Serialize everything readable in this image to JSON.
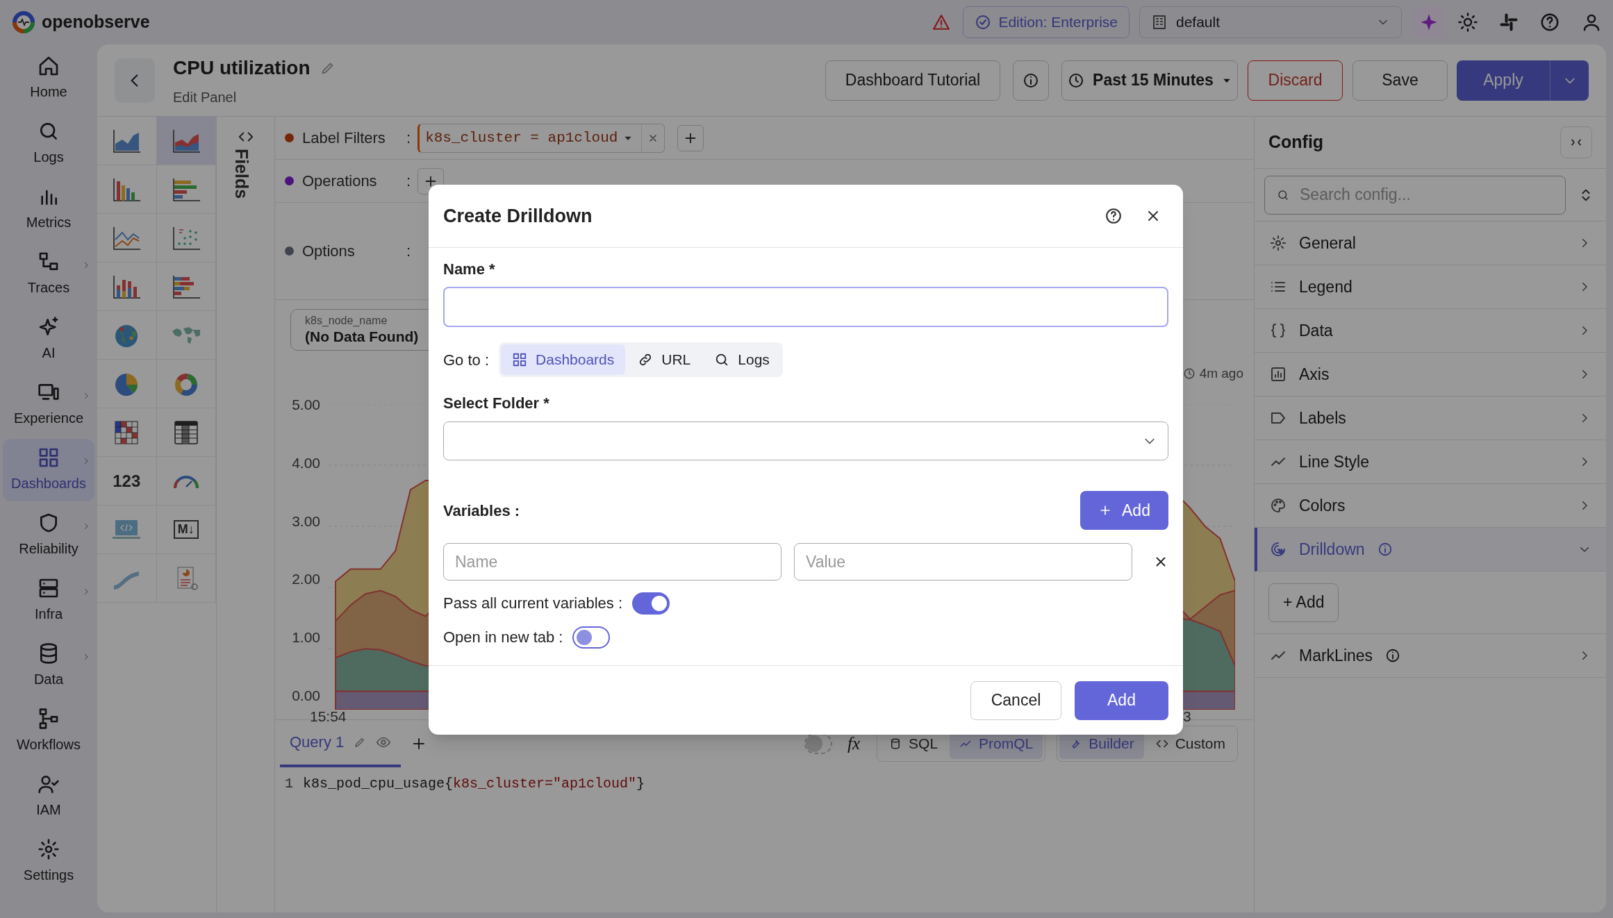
{
  "app": {
    "brand": "openobserve"
  },
  "top_bar": {
    "edition": "Edition: Enterprise",
    "organization": "default"
  },
  "nav": [
    {
      "label": "Home",
      "kind": "home",
      "submenu": false,
      "selected": false
    },
    {
      "label": "Logs",
      "kind": "logs",
      "submenu": false,
      "selected": false
    },
    {
      "label": "Metrics",
      "kind": "metrics",
      "submenu": false,
      "selected": false
    },
    {
      "label": "Traces",
      "kind": "traces",
      "submenu": true,
      "selected": false
    },
    {
      "label": "AI",
      "kind": "ai",
      "submenu": false,
      "selected": false
    },
    {
      "label": "Experience",
      "kind": "experience",
      "submenu": true,
      "selected": false
    },
    {
      "label": "Dashboards",
      "kind": "dashboards",
      "submenu": true,
      "selected": true
    },
    {
      "label": "Reliability",
      "kind": "reliability",
      "submenu": true,
      "selected": false
    },
    {
      "label": "Infra",
      "kind": "infra",
      "submenu": true,
      "selected": false
    },
    {
      "label": "Data",
      "kind": "data",
      "submenu": true,
      "selected": false
    },
    {
      "label": "Workflows",
      "kind": "workflows",
      "submenu": false,
      "selected": false
    },
    {
      "label": "IAM",
      "kind": "iam",
      "submenu": false,
      "selected": false
    },
    {
      "label": "Settings",
      "kind": "settings",
      "submenu": false,
      "selected": false
    }
  ],
  "panel": {
    "title": "CPU utilization",
    "subtitle": "Edit Panel",
    "tutorial": "Dashboard Tutorial",
    "time_range": "Past 15 Minutes",
    "discard": "Discard",
    "save": "Save",
    "apply": "Apply"
  },
  "chart_types": [
    {
      "kind": "area",
      "selected": false
    },
    {
      "kind": "area-stacked",
      "selected": true
    },
    {
      "kind": "bar",
      "selected": false
    },
    {
      "kind": "h-bar",
      "selected": false
    },
    {
      "kind": "line",
      "selected": false
    },
    {
      "kind": "scatter",
      "selected": false
    },
    {
      "kind": "stacked-bar",
      "selected": false
    },
    {
      "kind": "h-stacked",
      "selected": false
    },
    {
      "kind": "geomap",
      "selected": false
    },
    {
      "kind": "maps",
      "selected": false
    },
    {
      "kind": "pie",
      "selected": false
    },
    {
      "kind": "donut",
      "selected": false
    },
    {
      "kind": "heatmap",
      "selected": false
    },
    {
      "kind": "table",
      "selected": false
    },
    {
      "kind": "metric",
      "selected": false,
      "glyph": "123"
    },
    {
      "kind": "gauge",
      "selected": false
    },
    {
      "kind": "html",
      "selected": false
    },
    {
      "kind": "markdown",
      "selected": false,
      "glyph": "M↓"
    },
    {
      "kind": "sankey",
      "selected": false
    },
    {
      "kind": "custom",
      "selected": false
    }
  ],
  "fields_toggle": "Fields",
  "query_builder": [
    {
      "kind": "filters",
      "label": "Label Filters",
      "separator": ":",
      "chip": "k8s_cluster = ap1cloud"
    },
    {
      "kind": "operations",
      "label": "Operations",
      "separator": ":"
    },
    {
      "kind": "options",
      "label": "Options",
      "separator": ":"
    }
  ],
  "variable": {
    "name": "k8s_node_name",
    "value": "(No Data Found)"
  },
  "chart": {
    "y_labels": [
      "5.00",
      "4.00",
      "3.00",
      "2.00",
      "1.00",
      "0.00"
    ],
    "x_labels": [
      "15:54",
      "3"
    ],
    "refreshed": "4m ago"
  },
  "query_tabs": [
    {
      "label": "Query 1",
      "selected": true
    }
  ],
  "formula_label": "fx",
  "raw_toggle_on": false,
  "query_modes": [
    {
      "label": "SQL",
      "kind": "sql",
      "selected": false
    },
    {
      "label": "PromQL",
      "kind": "promql",
      "selected": true
    }
  ],
  "builder_modes": [
    {
      "label": "Builder",
      "kind": "builder",
      "selected": true
    },
    {
      "label": "Custom",
      "kind": "custom",
      "selected": false
    }
  ],
  "editor": {
    "line_number": "1",
    "segments": [
      {
        "text": "k8s_pod_cpu_usage{",
        "kind": "plain"
      },
      {
        "text": "k8s_cluster=\"ap1cloud\"",
        "kind": "string"
      },
      {
        "text": "}",
        "kind": "plain"
      }
    ]
  },
  "config": {
    "title": "Config",
    "search_placeholder": "Search config...",
    "add_button": "+ Add",
    "items": [
      {
        "label": "General",
        "kind": "general",
        "expanded": false,
        "info": false
      },
      {
        "label": "Legend",
        "kind": "legend",
        "expanded": false,
        "info": false
      },
      {
        "label": "Data",
        "kind": "data",
        "expanded": false,
        "info": false
      },
      {
        "label": "Axis",
        "kind": "axis",
        "expanded": false,
        "info": false
      },
      {
        "label": "Labels",
        "kind": "labels",
        "expanded": false,
        "info": false
      },
      {
        "label": "Line Style",
        "kind": "line-style",
        "expanded": false,
        "info": false
      },
      {
        "label": "Colors",
        "kind": "colors",
        "expanded": false,
        "info": false
      },
      {
        "label": "Drilldown",
        "kind": "drilldown",
        "expanded": true,
        "info": true
      },
      {
        "label": "MarkLines",
        "kind": "marklines",
        "expanded": false,
        "info": true
      }
    ]
  },
  "modal": {
    "title": "Create Drilldown",
    "name_label": "Name *",
    "goto_label": "Go to :",
    "targets": [
      {
        "label": "Dashboards",
        "kind": "dashboards",
        "selected": true
      },
      {
        "label": "URL",
        "kind": "url",
        "selected": false
      },
      {
        "label": "Logs",
        "kind": "logs",
        "selected": false
      }
    ],
    "folder_label": "Select Folder *",
    "variables_label": "Variables :",
    "add_variable": "Add",
    "variable_name_placeholder": "Name",
    "variable_value_placeholder": "Value",
    "toggles": [
      {
        "label": "Pass all current variables :",
        "on": true
      },
      {
        "label": "Open in new tab :",
        "on": false
      }
    ],
    "cancel": "Cancel",
    "submit": "Add"
  }
}
